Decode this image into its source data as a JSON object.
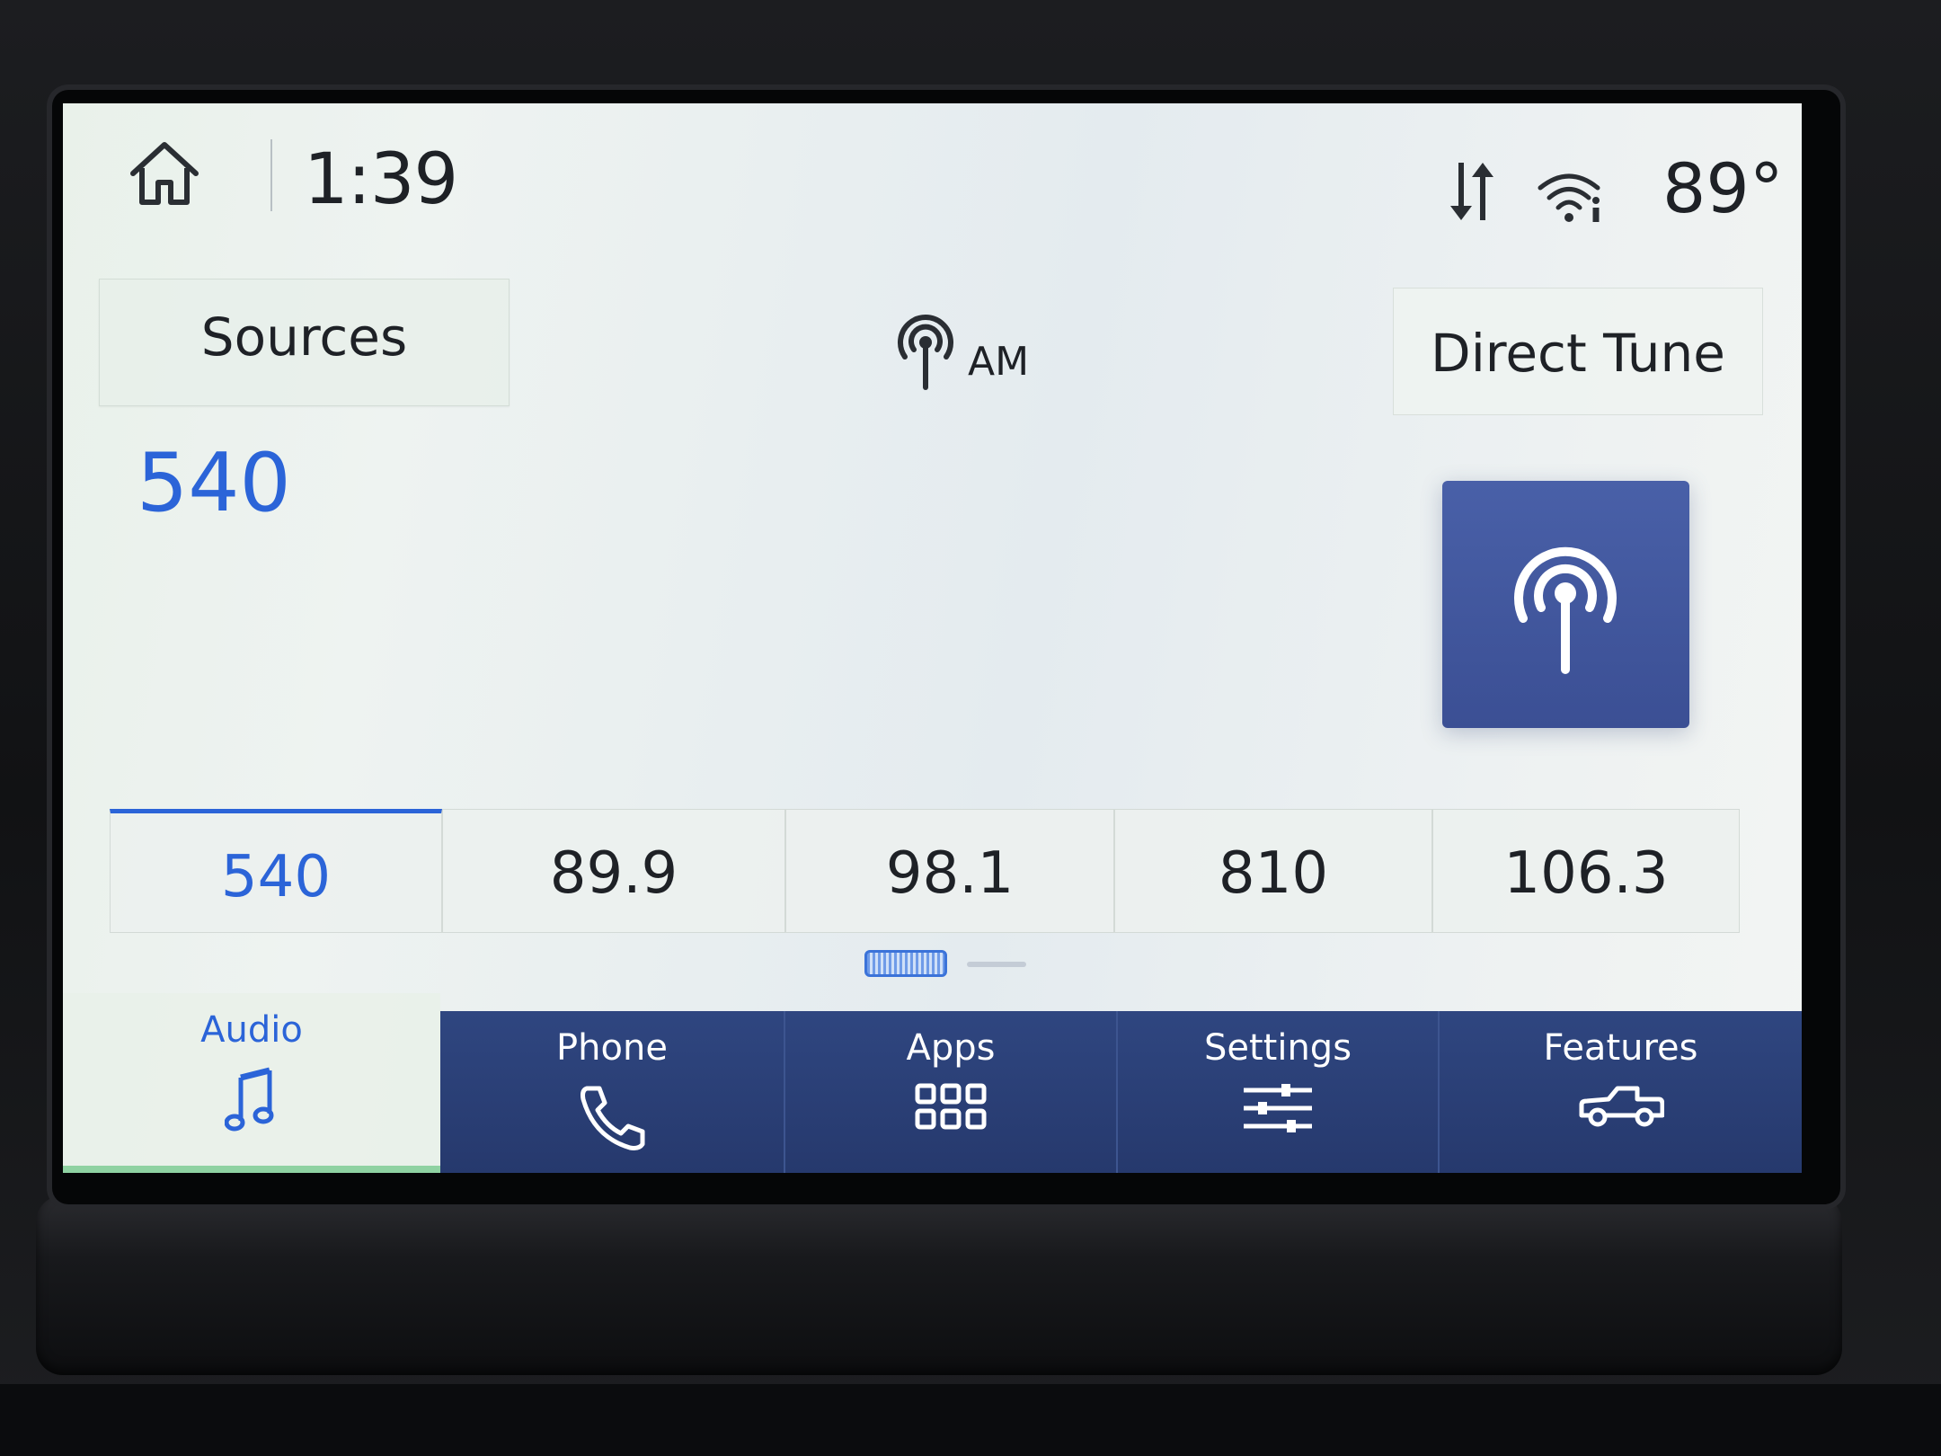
{
  "status_bar": {
    "home_icon": "home-icon",
    "time": "1:39",
    "data_icon": "data-transfer-icon",
    "wifi_icon": "wifi-info-icon",
    "temperature": "89°"
  },
  "header": {
    "sources_label": "Sources",
    "band_icon": "antenna-icon",
    "band_label": "AM",
    "direct_tune_label": "Direct Tune"
  },
  "now_playing": {
    "frequency": "540",
    "artwork_icon": "antenna-icon"
  },
  "presets": [
    {
      "label": "540",
      "active": true
    },
    {
      "label": "89.9",
      "active": false
    },
    {
      "label": "98.1",
      "active": false
    },
    {
      "label": "810",
      "active": false
    },
    {
      "label": "106.3",
      "active": false
    }
  ],
  "pagination": {
    "current": 1,
    "total": 2
  },
  "nav": {
    "audio": {
      "label": "Audio",
      "icon": "music-note-icon"
    },
    "phone": {
      "label": "Phone",
      "icon": "phone-icon"
    },
    "apps": {
      "label": "Apps",
      "icon": "apps-grid-icon"
    },
    "settings": {
      "label": "Settings",
      "icon": "sliders-icon"
    },
    "features": {
      "label": "Features",
      "icon": "pickup-truck-icon"
    }
  },
  "colors": {
    "accent": "#2b64d8",
    "nav_background": "#2f4680",
    "screen_background": "#eaf0ef",
    "text": "#1e2126"
  }
}
